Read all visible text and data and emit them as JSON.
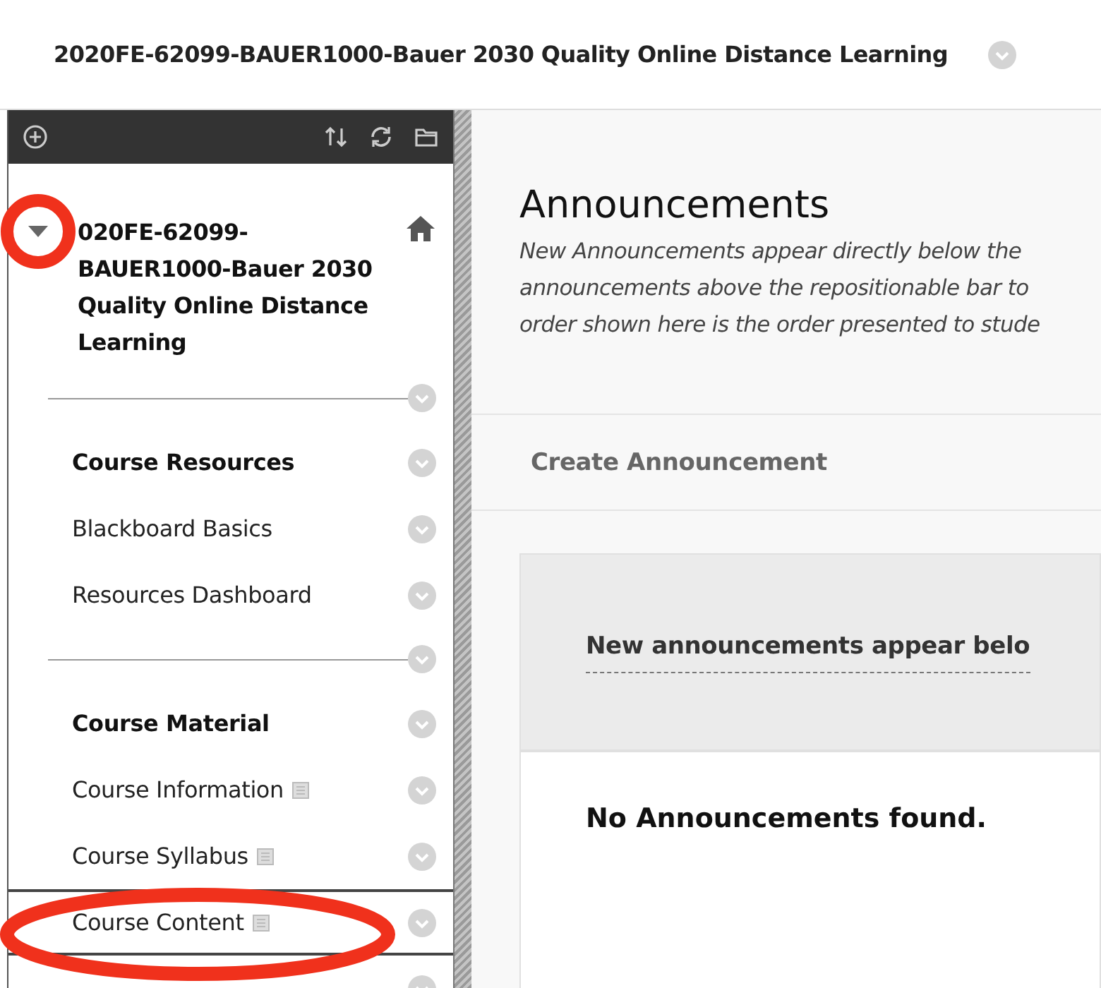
{
  "header": {
    "title": "2020FE-62099-BAUER1000-Bauer 2030 Quality Online Distance Learning"
  },
  "sidebar": {
    "course_title": "020FE-62099-BAUER1000-Bauer 2030 Quality Online Distance Learning",
    "expanded": true,
    "items": [
      {
        "kind": "divider"
      },
      {
        "kind": "heading",
        "label": "Course Resources"
      },
      {
        "kind": "link",
        "label": "Blackboard Basics",
        "selected": false,
        "page_icon": false
      },
      {
        "kind": "link",
        "label": "Resources Dashboard",
        "selected": false,
        "page_icon": false
      },
      {
        "kind": "divider"
      },
      {
        "kind": "heading",
        "label": "Course Material"
      },
      {
        "kind": "link",
        "label": "Course Information",
        "selected": false,
        "page_icon": true
      },
      {
        "kind": "link",
        "label": "Course Syllabus",
        "selected": false,
        "page_icon": true
      },
      {
        "kind": "link",
        "label": "Course Content",
        "selected": true,
        "page_icon": true
      },
      {
        "kind": "blank"
      }
    ]
  },
  "main": {
    "title": "Announcements",
    "description": "New Announcements appear directly below the\nannouncements above the repositionable bar to\norder shown here is the order presented to stude",
    "action": "Create Announcement",
    "bar_label": "New announcements appear belo",
    "empty_message": "No Announcements found."
  },
  "annotations": [
    {
      "kind": "circle"
    },
    {
      "kind": "ellipse"
    }
  ]
}
